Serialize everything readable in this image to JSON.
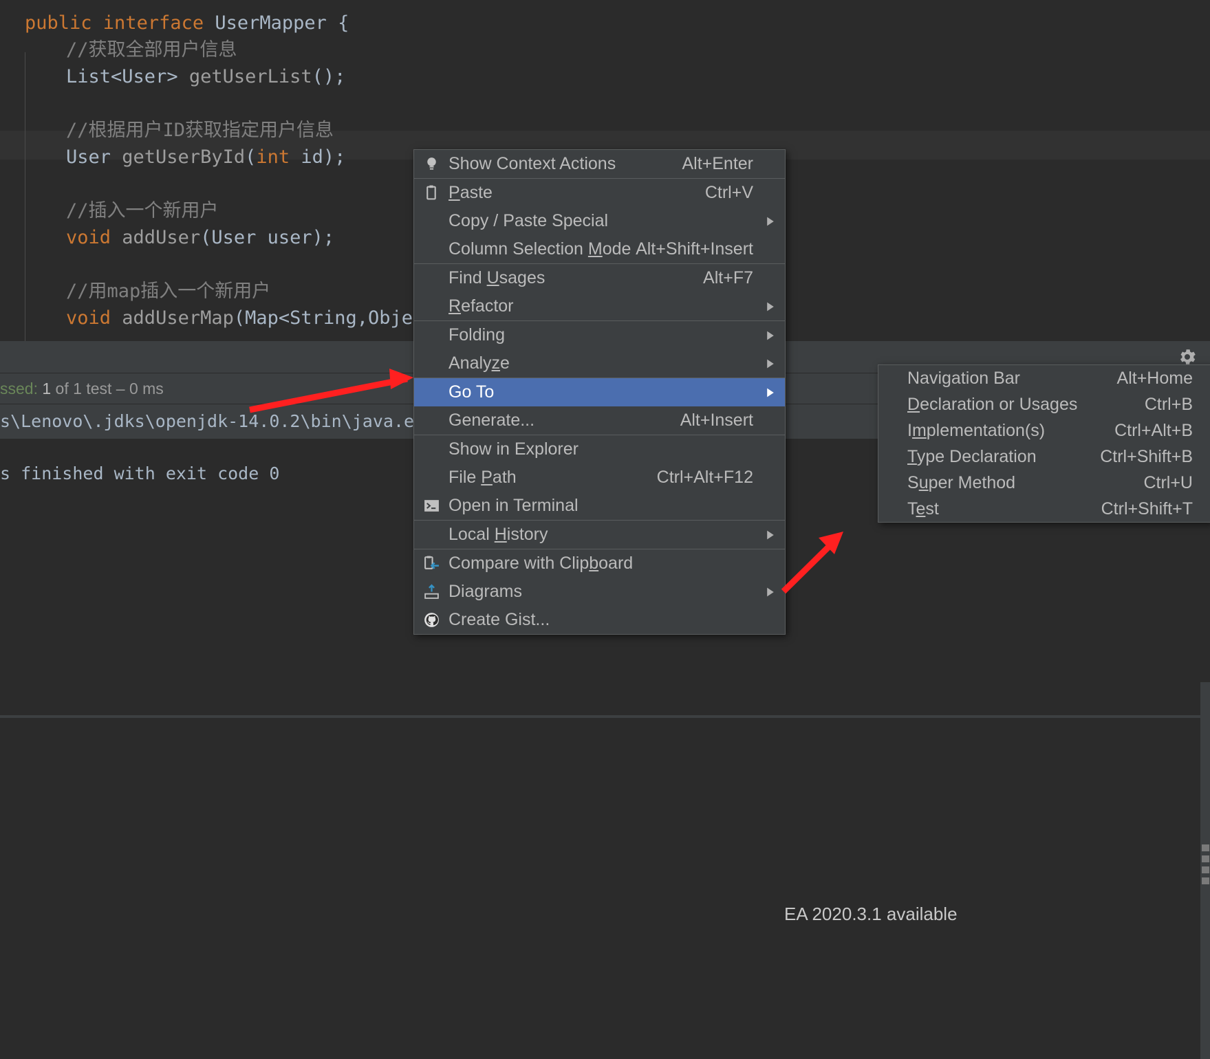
{
  "editor": {
    "lines": [
      {
        "indent": 0,
        "tokens": [
          {
            "t": "public ",
            "c": "kw"
          },
          {
            "t": "interface ",
            "c": "kw"
          },
          {
            "t": "UserMapper",
            "c": "typ"
          },
          {
            "t": " {",
            "c": "pln"
          }
        ]
      },
      {
        "indent": 1,
        "tokens": [
          {
            "t": "//获取全部用户信息",
            "c": "cmt"
          }
        ]
      },
      {
        "indent": 1,
        "tokens": [
          {
            "t": "List",
            "c": "typ"
          },
          {
            "t": "<",
            "c": "pln"
          },
          {
            "t": "User",
            "c": "typ"
          },
          {
            "t": "> ",
            "c": "pln"
          },
          {
            "t": "getUserList",
            "c": "mth"
          },
          {
            "t": "();",
            "c": "pln"
          }
        ]
      },
      {
        "indent": 1,
        "tokens": [
          {
            "t": "",
            "c": "pln"
          }
        ]
      },
      {
        "indent": 1,
        "tokens": [
          {
            "t": "//根据用户ID获取指定用户信息",
            "c": "cmt"
          }
        ]
      },
      {
        "indent": 1,
        "tokens": [
          {
            "t": "User ",
            "c": "typ"
          },
          {
            "t": "getUserById",
            "c": "mth"
          },
          {
            "t": "(",
            "c": "pln"
          },
          {
            "t": "int",
            "c": "kw"
          },
          {
            "t": " id);",
            "c": "pln"
          }
        ]
      },
      {
        "indent": 1,
        "tokens": [
          {
            "t": "",
            "c": "pln"
          }
        ]
      },
      {
        "indent": 1,
        "tokens": [
          {
            "t": "//插入一个新用户",
            "c": "cmt"
          }
        ]
      },
      {
        "indent": 1,
        "tokens": [
          {
            "t": "void",
            "c": "kw"
          },
          {
            "t": " ",
            "c": "pln"
          },
          {
            "t": "addUser",
            "c": "mth"
          },
          {
            "t": "(",
            "c": "pln"
          },
          {
            "t": "User",
            "c": "typ"
          },
          {
            "t": " user);",
            "c": "pln"
          }
        ]
      },
      {
        "indent": 1,
        "tokens": [
          {
            "t": "",
            "c": "pln"
          }
        ]
      },
      {
        "indent": 1,
        "tokens": [
          {
            "t": "//用map插入一个新用户",
            "c": "cmt"
          }
        ]
      },
      {
        "indent": 1,
        "tokens": [
          {
            "t": "void",
            "c": "kw"
          },
          {
            "t": " ",
            "c": "pln"
          },
          {
            "t": "addUserMap",
            "c": "mth"
          },
          {
            "t": "(",
            "c": "pln"
          },
          {
            "t": "Map",
            "c": "typ"
          },
          {
            "t": "<",
            "c": "pln"
          },
          {
            "t": "String",
            "c": "typ"
          },
          {
            "t": ",",
            "c": "pln"
          },
          {
            "t": "Object",
            "c": "typ"
          }
        ]
      }
    ]
  },
  "context_menu": {
    "items": [
      {
        "label": "Show Context Actions",
        "shortcut": "Alt+Enter",
        "icon": "lightbulb-icon",
        "submenu": false,
        "selected": false,
        "separator_above": false,
        "mnemonic": ""
      },
      {
        "label": "Paste",
        "shortcut": "Ctrl+V",
        "icon": "clipboard-icon",
        "submenu": false,
        "selected": false,
        "separator_above": true,
        "mnemonic": "P"
      },
      {
        "label": "Copy / Paste Special",
        "shortcut": "",
        "icon": "",
        "submenu": true,
        "selected": false,
        "separator_above": false,
        "mnemonic": ""
      },
      {
        "label": "Column Selection Mode",
        "shortcut": "Alt+Shift+Insert",
        "icon": "",
        "submenu": false,
        "selected": false,
        "separator_above": false,
        "mnemonic": "M"
      },
      {
        "label": "Find Usages",
        "shortcut": "Alt+F7",
        "icon": "",
        "submenu": false,
        "selected": false,
        "separator_above": true,
        "mnemonic": "U"
      },
      {
        "label": "Refactor",
        "shortcut": "",
        "icon": "",
        "submenu": true,
        "selected": false,
        "separator_above": false,
        "mnemonic": "R"
      },
      {
        "label": "Folding",
        "shortcut": "",
        "icon": "",
        "submenu": true,
        "selected": false,
        "separator_above": true,
        "mnemonic": ""
      },
      {
        "label": "Analyze",
        "shortcut": "",
        "icon": "",
        "submenu": true,
        "selected": false,
        "separator_above": false,
        "mnemonic": "z"
      },
      {
        "label": "Go To",
        "shortcut": "",
        "icon": "",
        "submenu": true,
        "selected": true,
        "separator_above": true,
        "mnemonic": ""
      },
      {
        "label": "Generate...",
        "shortcut": "Alt+Insert",
        "icon": "",
        "submenu": false,
        "selected": false,
        "separator_above": false,
        "mnemonic": ""
      },
      {
        "label": "Show in Explorer",
        "shortcut": "",
        "icon": "",
        "submenu": false,
        "selected": false,
        "separator_above": true,
        "mnemonic": ""
      },
      {
        "label": "File Path",
        "shortcut": "Ctrl+Alt+F12",
        "icon": "",
        "submenu": false,
        "selected": false,
        "separator_above": false,
        "mnemonic": "P"
      },
      {
        "label": "Open in Terminal",
        "shortcut": "",
        "icon": "terminal-icon",
        "submenu": false,
        "selected": false,
        "separator_above": false,
        "mnemonic": ""
      },
      {
        "label": "Local History",
        "shortcut": "",
        "icon": "",
        "submenu": true,
        "selected": false,
        "separator_above": true,
        "mnemonic": "H"
      },
      {
        "label": "Compare with Clipboard",
        "shortcut": "",
        "icon": "compare-clipboard-icon",
        "submenu": false,
        "selected": false,
        "separator_above": true,
        "mnemonic": "b"
      },
      {
        "label": "Diagrams",
        "shortcut": "",
        "icon": "diagrams-icon",
        "submenu": true,
        "selected": false,
        "separator_above": false,
        "mnemonic": ""
      },
      {
        "label": "Create Gist...",
        "shortcut": "",
        "icon": "github-icon",
        "submenu": false,
        "selected": false,
        "separator_above": false,
        "mnemonic": ""
      }
    ]
  },
  "submenu": {
    "parent": "Go To",
    "items": [
      {
        "label": "Navigation Bar",
        "shortcut": "Alt+Home",
        "mnemonic": ""
      },
      {
        "label": "Declaration or Usages",
        "shortcut": "Ctrl+B",
        "mnemonic": "D"
      },
      {
        "label": "Implementation(s)",
        "shortcut": "Ctrl+Alt+B",
        "mnemonic": "m"
      },
      {
        "label": "Type Declaration",
        "shortcut": "Ctrl+Shift+B",
        "mnemonic": "T"
      },
      {
        "label": "Super Method",
        "shortcut": "Ctrl+U",
        "mnemonic": "u"
      },
      {
        "label": "Test",
        "shortcut": "Ctrl+Shift+T",
        "mnemonic": "e"
      }
    ]
  },
  "run_panel": {
    "status_prefix": "ssed:",
    "status_count": "1",
    "status_rest": " of 1 test – 0 ms",
    "console_path": "s\\Lenovo\\.jdks\\openjdk-14.0.2\\bin\\java.e",
    "console_exit": "s finished with exit code 0",
    "gear_icon": "gear-icon"
  },
  "notification": {
    "text": "EA 2020.3.1 available"
  },
  "colors": {
    "editor_bg": "#2b2b2b",
    "menu_bg": "#3c3f41",
    "menu_border": "#5a5d5e",
    "selection": "#4b6eaf",
    "keyword": "#cc7832",
    "comment": "#808080",
    "text": "#bbbbbb",
    "annotation_arrow": "#ff2020"
  }
}
